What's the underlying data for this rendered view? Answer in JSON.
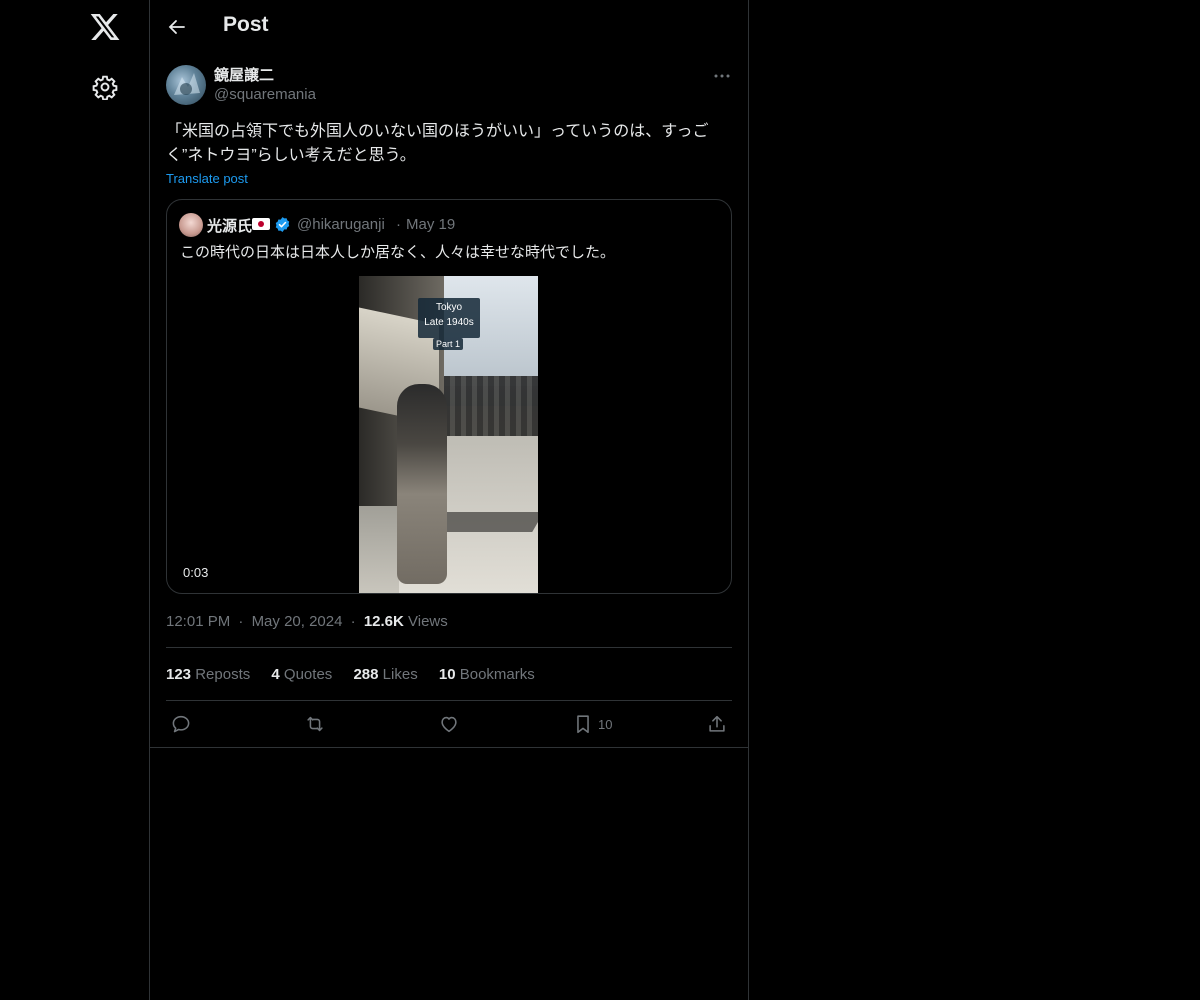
{
  "header": {
    "title": "Post"
  },
  "post": {
    "author_name": "鏡屋譲二",
    "author_handle": "@squaremania",
    "text": "「米国の占領下でも外国人のいない国のほうがいい」っていうのは、すっごく”ネトウヨ”らしい考えだと思う。",
    "translate_label": "Translate post",
    "time": "12:01 PM",
    "date": "May 20, 2024",
    "views_count": "12.6K",
    "views_label": "Views",
    "sep": "·"
  },
  "quote": {
    "name": "光源氏",
    "handle": "@hikaruganji",
    "sep": "·",
    "date": "May 19",
    "text": "この時代の日本は日本人しか居なく、人々は幸せな時代でした。",
    "video": {
      "overlay_line1": "Tokyo",
      "overlay_line2": "Late 1940s",
      "overlay_line3": "Part 1",
      "duration": "0:03"
    }
  },
  "stats": [
    {
      "count": "123",
      "label": "Reposts"
    },
    {
      "count": "4",
      "label": "Quotes"
    },
    {
      "count": "288",
      "label": "Likes"
    },
    {
      "count": "10",
      "label": "Bookmarks"
    }
  ],
  "actions": {
    "bookmark_count": "10"
  },
  "icons": {
    "logo": "x-logo-icon",
    "settings": "gear-icon",
    "back": "arrow-left-icon",
    "more": "more-horizontal-icon",
    "verified": "verified-badge-icon",
    "reply": "reply-icon",
    "repost": "repost-icon",
    "like": "heart-icon",
    "bookmark": "bookmark-icon",
    "share": "share-icon"
  },
  "colors": {
    "background": "#000000",
    "text": "#e7e9ea",
    "secondary": "#71767b",
    "link": "#1d9bf0",
    "border": "#2f3336"
  }
}
